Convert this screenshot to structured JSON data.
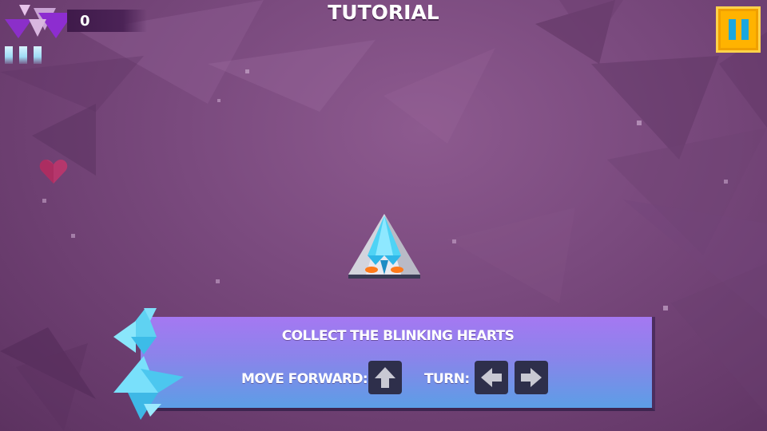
{
  "hud": {
    "score": "0",
    "lives_remaining": 3,
    "logo_icon": "triangle-logo-icon",
    "pause_icon": "pause-icon"
  },
  "title": "TUTORIAL",
  "tutorial": {
    "message": "COLLECT THE BLINKING HEARTS",
    "move_forward_label": "MOVE FORWARD:",
    "turn_label": "TURN:",
    "keys": {
      "move_forward": "arrow-up-key-icon",
      "turn_left": "arrow-left-key-icon",
      "turn_right": "arrow-right-key-icon"
    }
  },
  "pickups": [
    {
      "type": "heart-icon",
      "state": "blinking"
    }
  ],
  "colors": {
    "background": "#7a4a7e",
    "pause_button": "#ffb300",
    "pause_bars": "#1aa7e0",
    "heart": "#c2356b",
    "ship_cyan": "#4fd3f5",
    "panel_top": "#a578f2",
    "panel_bottom": "#5c9ee6",
    "key_bg": "#2e2f4b"
  }
}
